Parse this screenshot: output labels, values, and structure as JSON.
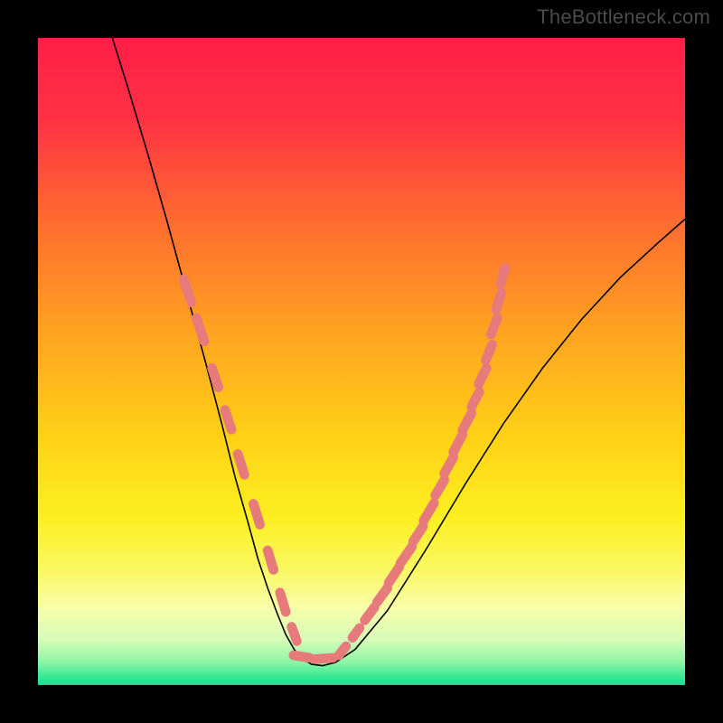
{
  "watermark": "TheBottleneck.com",
  "colors": {
    "frame": "#000000",
    "gradient_stops": [
      {
        "offset": 0.0,
        "color": "#ff1f47"
      },
      {
        "offset": 0.12,
        "color": "#ff3044"
      },
      {
        "offset": 0.28,
        "color": "#ff6a30"
      },
      {
        "offset": 0.45,
        "color": "#ffa220"
      },
      {
        "offset": 0.62,
        "color": "#ffd216"
      },
      {
        "offset": 0.74,
        "color": "#fcef20"
      },
      {
        "offset": 0.82,
        "color": "#faf860"
      },
      {
        "offset": 0.88,
        "color": "#f8fda8"
      },
      {
        "offset": 0.93,
        "color": "#d6fcb8"
      },
      {
        "offset": 0.965,
        "color": "#8cf6a6"
      },
      {
        "offset": 0.985,
        "color": "#3fe896"
      },
      {
        "offset": 1.0,
        "color": "#16df90"
      }
    ],
    "curve_stroke": "#000000",
    "annotation": "#e77b7b"
  },
  "chart_data": {
    "type": "line",
    "title": "",
    "xlabel": "",
    "ylabel": "",
    "xlim": [
      0,
      1000
    ],
    "ylim": [
      0,
      1000
    ],
    "grid": false,
    "series": [
      {
        "name": "bottleneck-curve",
        "x": [
          115,
          140,
          170,
          200,
          230,
          260,
          285,
          305,
          325,
          340,
          355,
          370,
          383,
          396,
          409,
          423,
          440,
          460,
          490,
          540,
          600,
          660,
          720,
          780,
          840,
          900,
          960,
          1000
        ],
        "values": [
          1000,
          920,
          820,
          715,
          605,
          495,
          400,
          320,
          250,
          195,
          150,
          110,
          78,
          55,
          40,
          32,
          30,
          35,
          55,
          115,
          210,
          310,
          405,
          490,
          565,
          630,
          685,
          720
        ]
      }
    ],
    "annotations": {
      "left_dashes": [
        {
          "x1": 225,
          "y1": 627,
          "x2": 237,
          "y2": 591
        },
        {
          "x1": 245,
          "y1": 567,
          "x2": 257,
          "y2": 531
        },
        {
          "x1": 269,
          "y1": 490,
          "x2": 279,
          "y2": 460
        },
        {
          "x1": 289,
          "y1": 425,
          "x2": 299,
          "y2": 395
        },
        {
          "x1": 309,
          "y1": 357,
          "x2": 319,
          "y2": 325
        },
        {
          "x1": 333,
          "y1": 280,
          "x2": 343,
          "y2": 248
        },
        {
          "x1": 355,
          "y1": 208,
          "x2": 364,
          "y2": 178
        },
        {
          "x1": 374,
          "y1": 143,
          "x2": 383,
          "y2": 113
        },
        {
          "x1": 392,
          "y1": 90,
          "x2": 400,
          "y2": 68
        }
      ],
      "right_dashes": [
        {
          "x1": 465,
          "y1": 46,
          "x2": 476,
          "y2": 60
        },
        {
          "x1": 486,
          "y1": 73,
          "x2": 497,
          "y2": 88
        },
        {
          "x1": 505,
          "y1": 100,
          "x2": 520,
          "y2": 120
        },
        {
          "x1": 524,
          "y1": 128,
          "x2": 540,
          "y2": 150
        },
        {
          "x1": 542,
          "y1": 158,
          "x2": 558,
          "y2": 182
        },
        {
          "x1": 560,
          "y1": 188,
          "x2": 578,
          "y2": 214
        },
        {
          "x1": 580,
          "y1": 222,
          "x2": 595,
          "y2": 245
        },
        {
          "x1": 596,
          "y1": 254,
          "x2": 612,
          "y2": 281
        },
        {
          "x1": 614,
          "y1": 293,
          "x2": 628,
          "y2": 317
        },
        {
          "x1": 628,
          "y1": 327,
          "x2": 642,
          "y2": 352
        },
        {
          "x1": 642,
          "y1": 360,
          "x2": 656,
          "y2": 387
        },
        {
          "x1": 656,
          "y1": 394,
          "x2": 670,
          "y2": 420
        },
        {
          "x1": 670,
          "y1": 430,
          "x2": 682,
          "y2": 453
        },
        {
          "x1": 681,
          "y1": 465,
          "x2": 693,
          "y2": 490
        },
        {
          "x1": 692,
          "y1": 502,
          "x2": 702,
          "y2": 526
        },
        {
          "x1": 700,
          "y1": 542,
          "x2": 710,
          "y2": 567
        },
        {
          "x1": 708,
          "y1": 580,
          "x2": 716,
          "y2": 606
        },
        {
          "x1": 715,
          "y1": 620,
          "x2": 722,
          "y2": 645
        }
      ],
      "bottom_dashes": [
        {
          "x1": 395,
          "y1": 46,
          "x2": 420,
          "y2": 42
        },
        {
          "x1": 428,
          "y1": 40,
          "x2": 456,
          "y2": 42
        }
      ]
    }
  }
}
